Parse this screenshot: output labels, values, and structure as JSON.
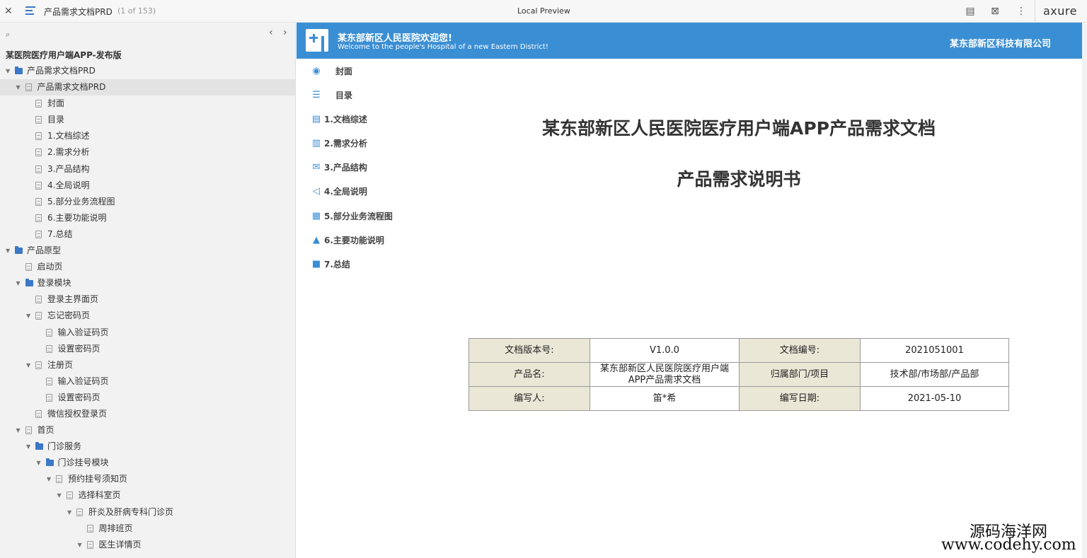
{
  "topbar": {
    "close": "✕",
    "title": "产品需求文档PRD",
    "count": "(1 of 153)",
    "center": "Local Preview",
    "logo": "axure"
  },
  "leftpane": {
    "project_title": "某医院医疗用户端APP-发布版",
    "tree": [
      {
        "label": "产品需求文档PRD",
        "type": "folder",
        "depth": 0,
        "expanded": true
      },
      {
        "label": "产品需求文档PRD",
        "type": "page",
        "depth": 1,
        "expanded": true,
        "selected": true
      },
      {
        "label": "封面",
        "type": "page",
        "depth": 2
      },
      {
        "label": "目录",
        "type": "page",
        "depth": 2
      },
      {
        "label": "1.文档综述",
        "type": "page",
        "depth": 2
      },
      {
        "label": "2.需求分析",
        "type": "page",
        "depth": 2
      },
      {
        "label": "3.产品结构",
        "type": "page",
        "depth": 2
      },
      {
        "label": "4.全局说明",
        "type": "page",
        "depth": 2
      },
      {
        "label": "5.部分业务流程图",
        "type": "page",
        "depth": 2
      },
      {
        "label": "6.主要功能说明",
        "type": "page",
        "depth": 2
      },
      {
        "label": "7.总结",
        "type": "page",
        "depth": 2
      },
      {
        "label": "产品原型",
        "type": "folder",
        "depth": 0,
        "expanded": true
      },
      {
        "label": "启动页",
        "type": "page",
        "depth": 1
      },
      {
        "label": "登录模块",
        "type": "folder",
        "depth": 1,
        "expanded": true
      },
      {
        "label": "登录主界面页",
        "type": "page",
        "depth": 2
      },
      {
        "label": "忘记密码页",
        "type": "page",
        "depth": 2,
        "expanded": true
      },
      {
        "label": "输入验证码页",
        "type": "page",
        "depth": 3
      },
      {
        "label": "设置密码页",
        "type": "page",
        "depth": 3
      },
      {
        "label": "注册页",
        "type": "page",
        "depth": 2,
        "expanded": true
      },
      {
        "label": "输入验证码页",
        "type": "page",
        "depth": 3
      },
      {
        "label": "设置密码页",
        "type": "page",
        "depth": 3
      },
      {
        "label": "微信授权登录页",
        "type": "page",
        "depth": 2
      },
      {
        "label": "首页",
        "type": "page",
        "depth": 1,
        "expanded": true
      },
      {
        "label": "门诊服务",
        "type": "folder",
        "depth": 2,
        "expanded": true
      },
      {
        "label": "门诊挂号模块",
        "type": "folder",
        "depth": 3,
        "expanded": true
      },
      {
        "label": "预约挂号须知页",
        "type": "page",
        "depth": 4,
        "expanded": true
      },
      {
        "label": "选择科室页",
        "type": "page",
        "depth": 5,
        "expanded": true
      },
      {
        "label": "肝炎及肝病专科门诊页",
        "type": "page",
        "depth": 6,
        "expanded": true
      },
      {
        "label": "周排班页",
        "type": "page",
        "depth": 7
      },
      {
        "label": "医生详情页",
        "type": "page",
        "depth": 7,
        "expanded": true
      }
    ]
  },
  "banner": {
    "title_cn": "某东部新区人民医院欢迎您!",
    "title_en": "Welcome to the people's Hospital of a new Eastern District!",
    "right": "某东部新区科技有限公司"
  },
  "toc": [
    {
      "label": "封面",
      "icon": "layers-icon",
      "glyph": "◉"
    },
    {
      "label": "目录",
      "icon": "list-icon",
      "glyph": "☰"
    },
    {
      "label": "1.文档综述",
      "icon": "document-icon",
      "glyph": "▤"
    },
    {
      "label": "2.需求分析",
      "icon": "notebook-icon",
      "glyph": "▥"
    },
    {
      "label": "3.产品结构",
      "icon": "envelope-icon",
      "glyph": "✉"
    },
    {
      "label": "4.全局说明",
      "icon": "speaker-icon",
      "glyph": "◁"
    },
    {
      "label": "5.部分业务流程图",
      "icon": "clipboard-icon",
      "glyph": "▦"
    },
    {
      "label": "6.主要功能说明",
      "icon": "bell-icon",
      "glyph": "▲"
    },
    {
      "label": "7.总结",
      "icon": "stack-icon",
      "glyph": "■"
    }
  ],
  "document": {
    "title": "某东部新区人民医院医疗用户端APP产品需求文档",
    "subtitle": "产品需求说明书"
  },
  "info_table": [
    [
      "文档版本号:",
      "V1.0.0",
      "文档编号:",
      "2021051001"
    ],
    [
      "产品名:",
      "某东部新区人民医院医疗用户端APP产品需求文档",
      "归属部门/项目",
      "技术部/市场部/产品部"
    ],
    [
      "编写人:",
      "笛*希",
      "编写日期:",
      "2021-05-10"
    ]
  ],
  "watermark": {
    "cn": "源码海洋网",
    "url": "www.codehy.com"
  }
}
